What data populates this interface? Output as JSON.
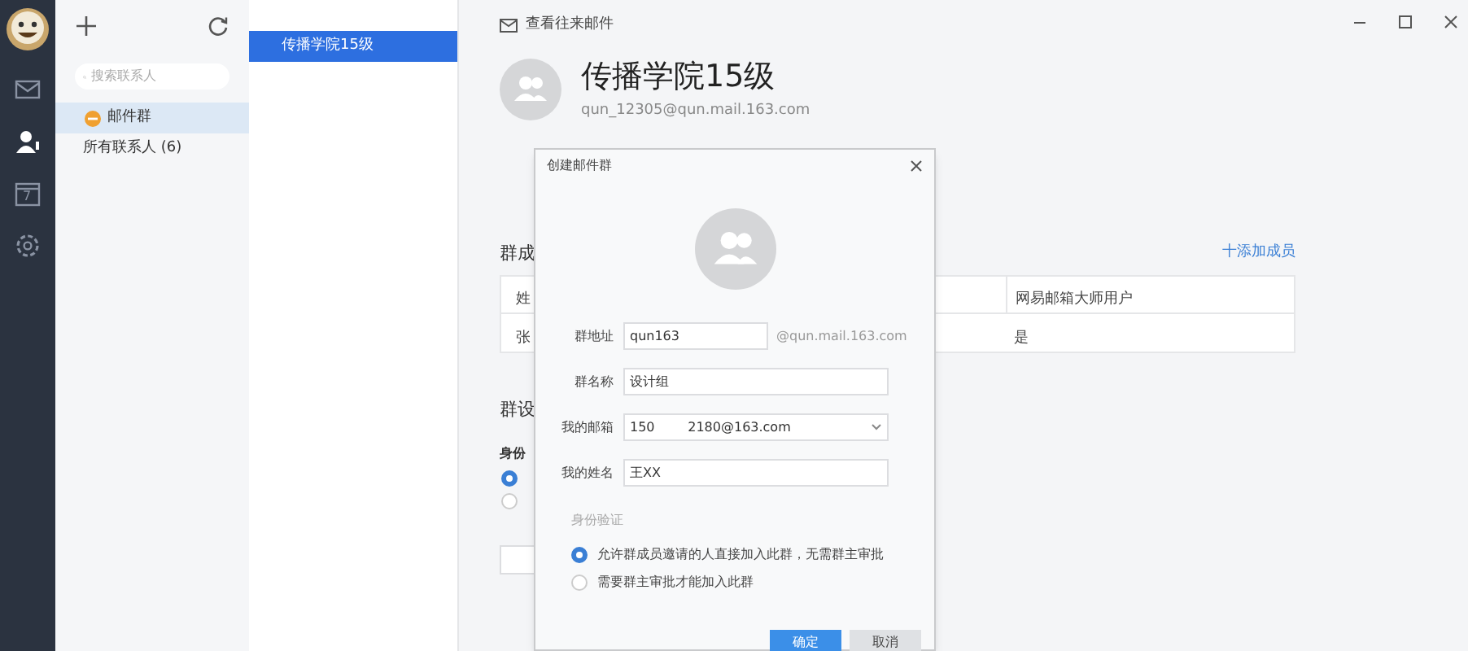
{
  "rail": {
    "calendar_day": "7",
    "items": [
      {
        "kind": "mail",
        "selected": false
      },
      {
        "kind": "contacts",
        "selected": true
      },
      {
        "kind": "calendar",
        "selected": false
      },
      {
        "kind": "settings",
        "selected": false
      }
    ]
  },
  "contacts_panel": {
    "search": {
      "placeholder": "搜索联系人"
    },
    "items": [
      {
        "label": "邮件群",
        "kind": "group",
        "selected": true
      },
      {
        "label": "所有联系人 (6)",
        "kind": "plain",
        "selected": false
      }
    ]
  },
  "group_list": [
    {
      "label": "传播学院15级",
      "selected": true
    }
  ],
  "detail": {
    "header_link": "查看往来邮件",
    "title": "传播学院15级",
    "email": "qun_12305@qun.mail.163.com",
    "members_heading": "群成",
    "add_member": "十添加成员",
    "table": {
      "columns": [
        "姓",
        "网易邮箱大师用户"
      ],
      "rows": [
        [
          "张",
          "是"
        ]
      ]
    },
    "settings_heading": "群设",
    "verify_label": "身份",
    "options": [
      {
        "selected": true
      },
      {
        "selected": false
      }
    ]
  },
  "dialog": {
    "title": "创建邮件群",
    "fields": [
      {
        "label": "群地址",
        "value": "qun163",
        "suffix": "@qun.mail.163.com",
        "kind": "text"
      },
      {
        "label": "群名称",
        "value": "设计组",
        "kind": "text"
      },
      {
        "label": "我的邮箱",
        "value": "150        2180@163.com",
        "kind": "select"
      },
      {
        "label": "我的姓名",
        "value": "王XX",
        "kind": "text"
      }
    ],
    "verify_heading": "身份验证",
    "options": [
      {
        "label": "允许群成员邀请的人直接加入此群，无需群主审批",
        "selected": true
      },
      {
        "label": "需要群主审批才能加入此群",
        "selected": false
      }
    ],
    "buttons": [
      {
        "label": "确定",
        "kind": "primary"
      },
      {
        "label": "取消",
        "kind": "secondary"
      }
    ]
  }
}
